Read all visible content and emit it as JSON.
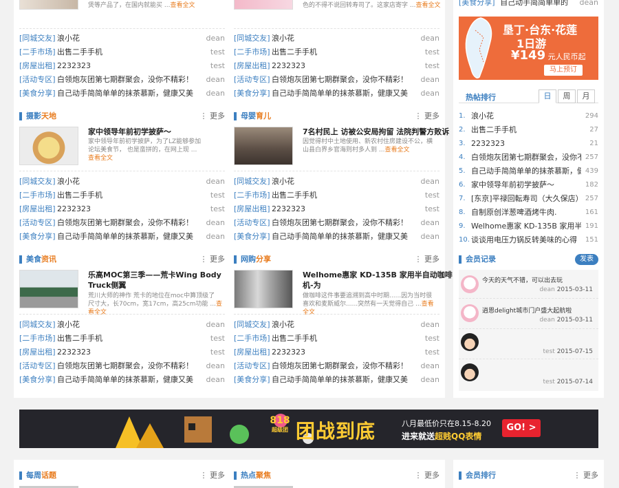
{
  "top_fragments": {
    "left_desc": "煲等产品了，在国内就能买 ...",
    "left_more": "查看全文",
    "mid_desc": "色的不得不说回转寿司了。这家店寄字 ...",
    "mid_more": "查看全文",
    "right_tag": "[美食分享]",
    "right_title": "自己动手简简单单的",
    "right_author": "dean"
  },
  "list_rows": [
    {
      "tag": "[同城交友]",
      "title": "浪小花",
      "author": "dean"
    },
    {
      "tag": "[二手市场]",
      "title": "出售二手手机",
      "author": "test"
    },
    {
      "tag": "[房屋出租]",
      "title": "2232323",
      "author": "test"
    },
    {
      "tag": "[活动专区]",
      "title": "白领炮灰团第七期群聚会，没你不精彩！",
      "author": "dean"
    },
    {
      "tag": "[美食分享]",
      "title": "自己动手简简单单的抹茶慕斯，健康又美",
      "author": "dean"
    }
  ],
  "sections": {
    "photo": {
      "title_a": "摄影",
      "title_b": "天地",
      "more": "更多",
      "feat_title": "家中领导年前初学披萨～",
      "feat_desc": "家中领导年前初学披萨，为了LZ能够参加论坛美食节， 也是蛮拼的，在网上现 ...",
      "feat_more": "查看全文"
    },
    "baby": {
      "title_a": "母婴",
      "title_b": "育儿",
      "more": "更多",
      "feat_title": "7名村民上 访被公安局拘留 法院判警方败诉",
      "feat_desc": "因觉得村中土地使用、新农村住房建设不公，横山县白界乡官海则村多人到 ...",
      "feat_more": "查看全文"
    },
    "food": {
      "title_a": "美食",
      "title_b": "资讯",
      "more": "更多",
      "feat_title_1": "乐高MOC第三季——荒卡Wing Body",
      "feat_title_2": "Truck侧翼",
      "feat_desc": "荒川大师的神作 荒卡的地位在moc中算顶级了 尺寸大，长70cm，宽17cm，高25cm功能 ...",
      "feat_more": "查看全文"
    },
    "shop": {
      "title_a": "网购",
      "title_b": "分享",
      "more": "更多",
      "feat_title_1": "Welhome惠家 KD-135B 家用半自动咖啡",
      "feat_title_2": "机-为",
      "feat_desc": "做咖啡这件事要追溯到高中时期......因为当时很喜欢和麦斯威尔......突然有一天觉得自己 ...",
      "feat_more": "查看全文"
    }
  },
  "ad_tour": {
    "line1": "垦丁·台东·花莲",
    "line2": "1日游",
    "price": "¥149",
    "price_unit": "元人民币起",
    "button": "马上预订"
  },
  "hot_rank": {
    "title": "热帖排行",
    "tabs": [
      "日",
      "周",
      "月"
    ],
    "items": [
      {
        "num": "1.",
        "title": "浪小花",
        "count": "294"
      },
      {
        "num": "2.",
        "title": "出售二手手机",
        "count": "27"
      },
      {
        "num": "3.",
        "title": "2232323",
        "count": "21"
      },
      {
        "num": "4.",
        "title": "白领炮灰团第七期群聚会，没你不",
        "count": "257"
      },
      {
        "num": "5.",
        "title": "自己动手简简单单的抹茶慕斯，健",
        "count": "439"
      },
      {
        "num": "6.",
        "title": "家中领导年前初学披萨～",
        "count": "182"
      },
      {
        "num": "7.",
        "title": "[东京]平禄回転寿司（大久保店）",
        "count": "257"
      },
      {
        "num": "8.",
        "title": "自制原创洋葱啤酒烤牛肉.",
        "count": "161"
      },
      {
        "num": "9.",
        "title": "Welhome惠家 KD-135B 家用半",
        "count": "191"
      },
      {
        "num": "10.",
        "title": "谈谈用电压力锅反转美味的心得",
        "count": "151"
      }
    ]
  },
  "member_records": {
    "title": "会员记录",
    "post_button": "发表",
    "items": [
      {
        "text": "今天的天气不错，可以出去玩",
        "author": "dean",
        "date": "2015-03-11"
      },
      {
        "text": "逍恩delight城市门户盛大起航啦",
        "author": "dean",
        "date": "2015-03-11"
      },
      {
        "text": "",
        "author": "test",
        "date": "2015-07-15"
      },
      {
        "text": "",
        "author": "test",
        "date": "2015-07-14"
      }
    ]
  },
  "banner": {
    "badge_1": "818",
    "badge_2": "超级团",
    "headline": "团战到底",
    "sub_1": "八月最低价只在8.15-8.20",
    "sub_2a": "进来就送",
    "sub_2b": "超贱QQ表情",
    "button": "GO! >"
  },
  "bottom": {
    "weekly": {
      "title_a": "每周",
      "title_b": "话题",
      "more": "更多"
    },
    "hot": {
      "title_a": "热点",
      "title_b": "聚焦",
      "more": "更多"
    },
    "member_rank": {
      "title": "会员排行",
      "more": "更多"
    }
  },
  "colors": {
    "accent": "#3c7fc0",
    "orange": "#e87c1f",
    "ad_orange": "#ee6c3b",
    "banner_bg": "#25252b"
  }
}
